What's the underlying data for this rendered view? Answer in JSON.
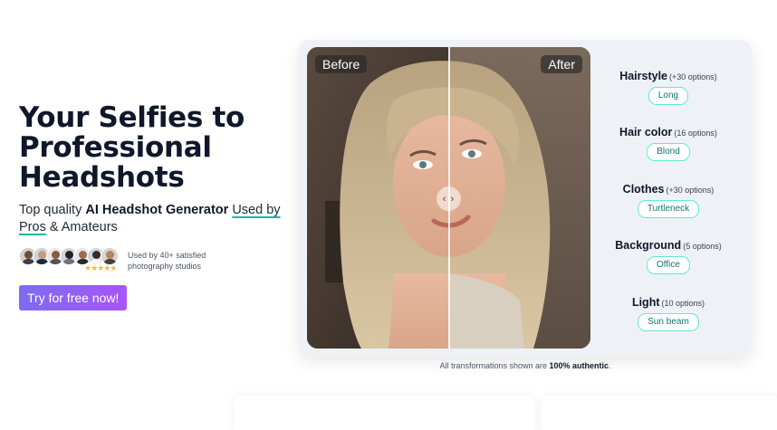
{
  "hero": {
    "headline_1": "Your Selfies to",
    "headline_2": "Professional",
    "headline_3": "Headshots",
    "sub_prefix": "Top quality ",
    "sub_bold": "AI Headshot Generator",
    "sub_link": "Used by Pros",
    "sub_suffix": " & Amateurs",
    "social_proof": "Used by 40+ satisfied photography studios",
    "stars": "★★★★★",
    "cta": "Try for free now!"
  },
  "compare": {
    "before_label": "Before",
    "after_label": "After",
    "handle_icon": "‹ ›"
  },
  "options": [
    {
      "title": "Hairstyle",
      "count": "(+30 options)",
      "value": "Long"
    },
    {
      "title": "Hair color",
      "count": "(16 options)",
      "value": "Blond"
    },
    {
      "title": "Clothes",
      "count": "(+30 options)",
      "value": "Turtleneck"
    },
    {
      "title": "Background",
      "count": "(5 options)",
      "value": "Office"
    },
    {
      "title": "Light",
      "count": "(10 options)",
      "value": "Sun beam"
    }
  ],
  "caption": {
    "prefix": "All transformations shown are ",
    "bold": "100% authentic",
    "suffix": "."
  },
  "colors": {
    "accent_teal": "#14b8a6",
    "cta_gradient_start": "#7c6cf0",
    "cta_gradient_end": "#a855f7",
    "star": "#fbbf24"
  }
}
